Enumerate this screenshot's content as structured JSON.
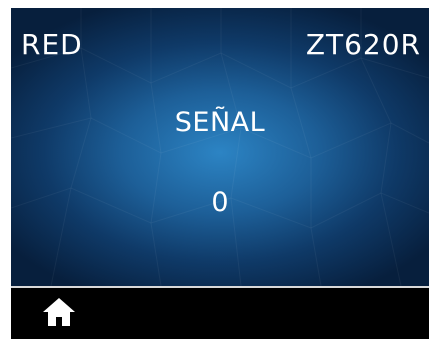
{
  "header": {
    "left_title": "RED",
    "right_title": "ZT620R"
  },
  "main": {
    "label": "SEÑAL",
    "value": "0"
  },
  "footer": {
    "home_icon": "home-icon"
  },
  "colors": {
    "background_center": "#2c84c4",
    "background_edge": "#071f3d",
    "text": "#ffffff",
    "divider": "#d9d9d9"
  }
}
